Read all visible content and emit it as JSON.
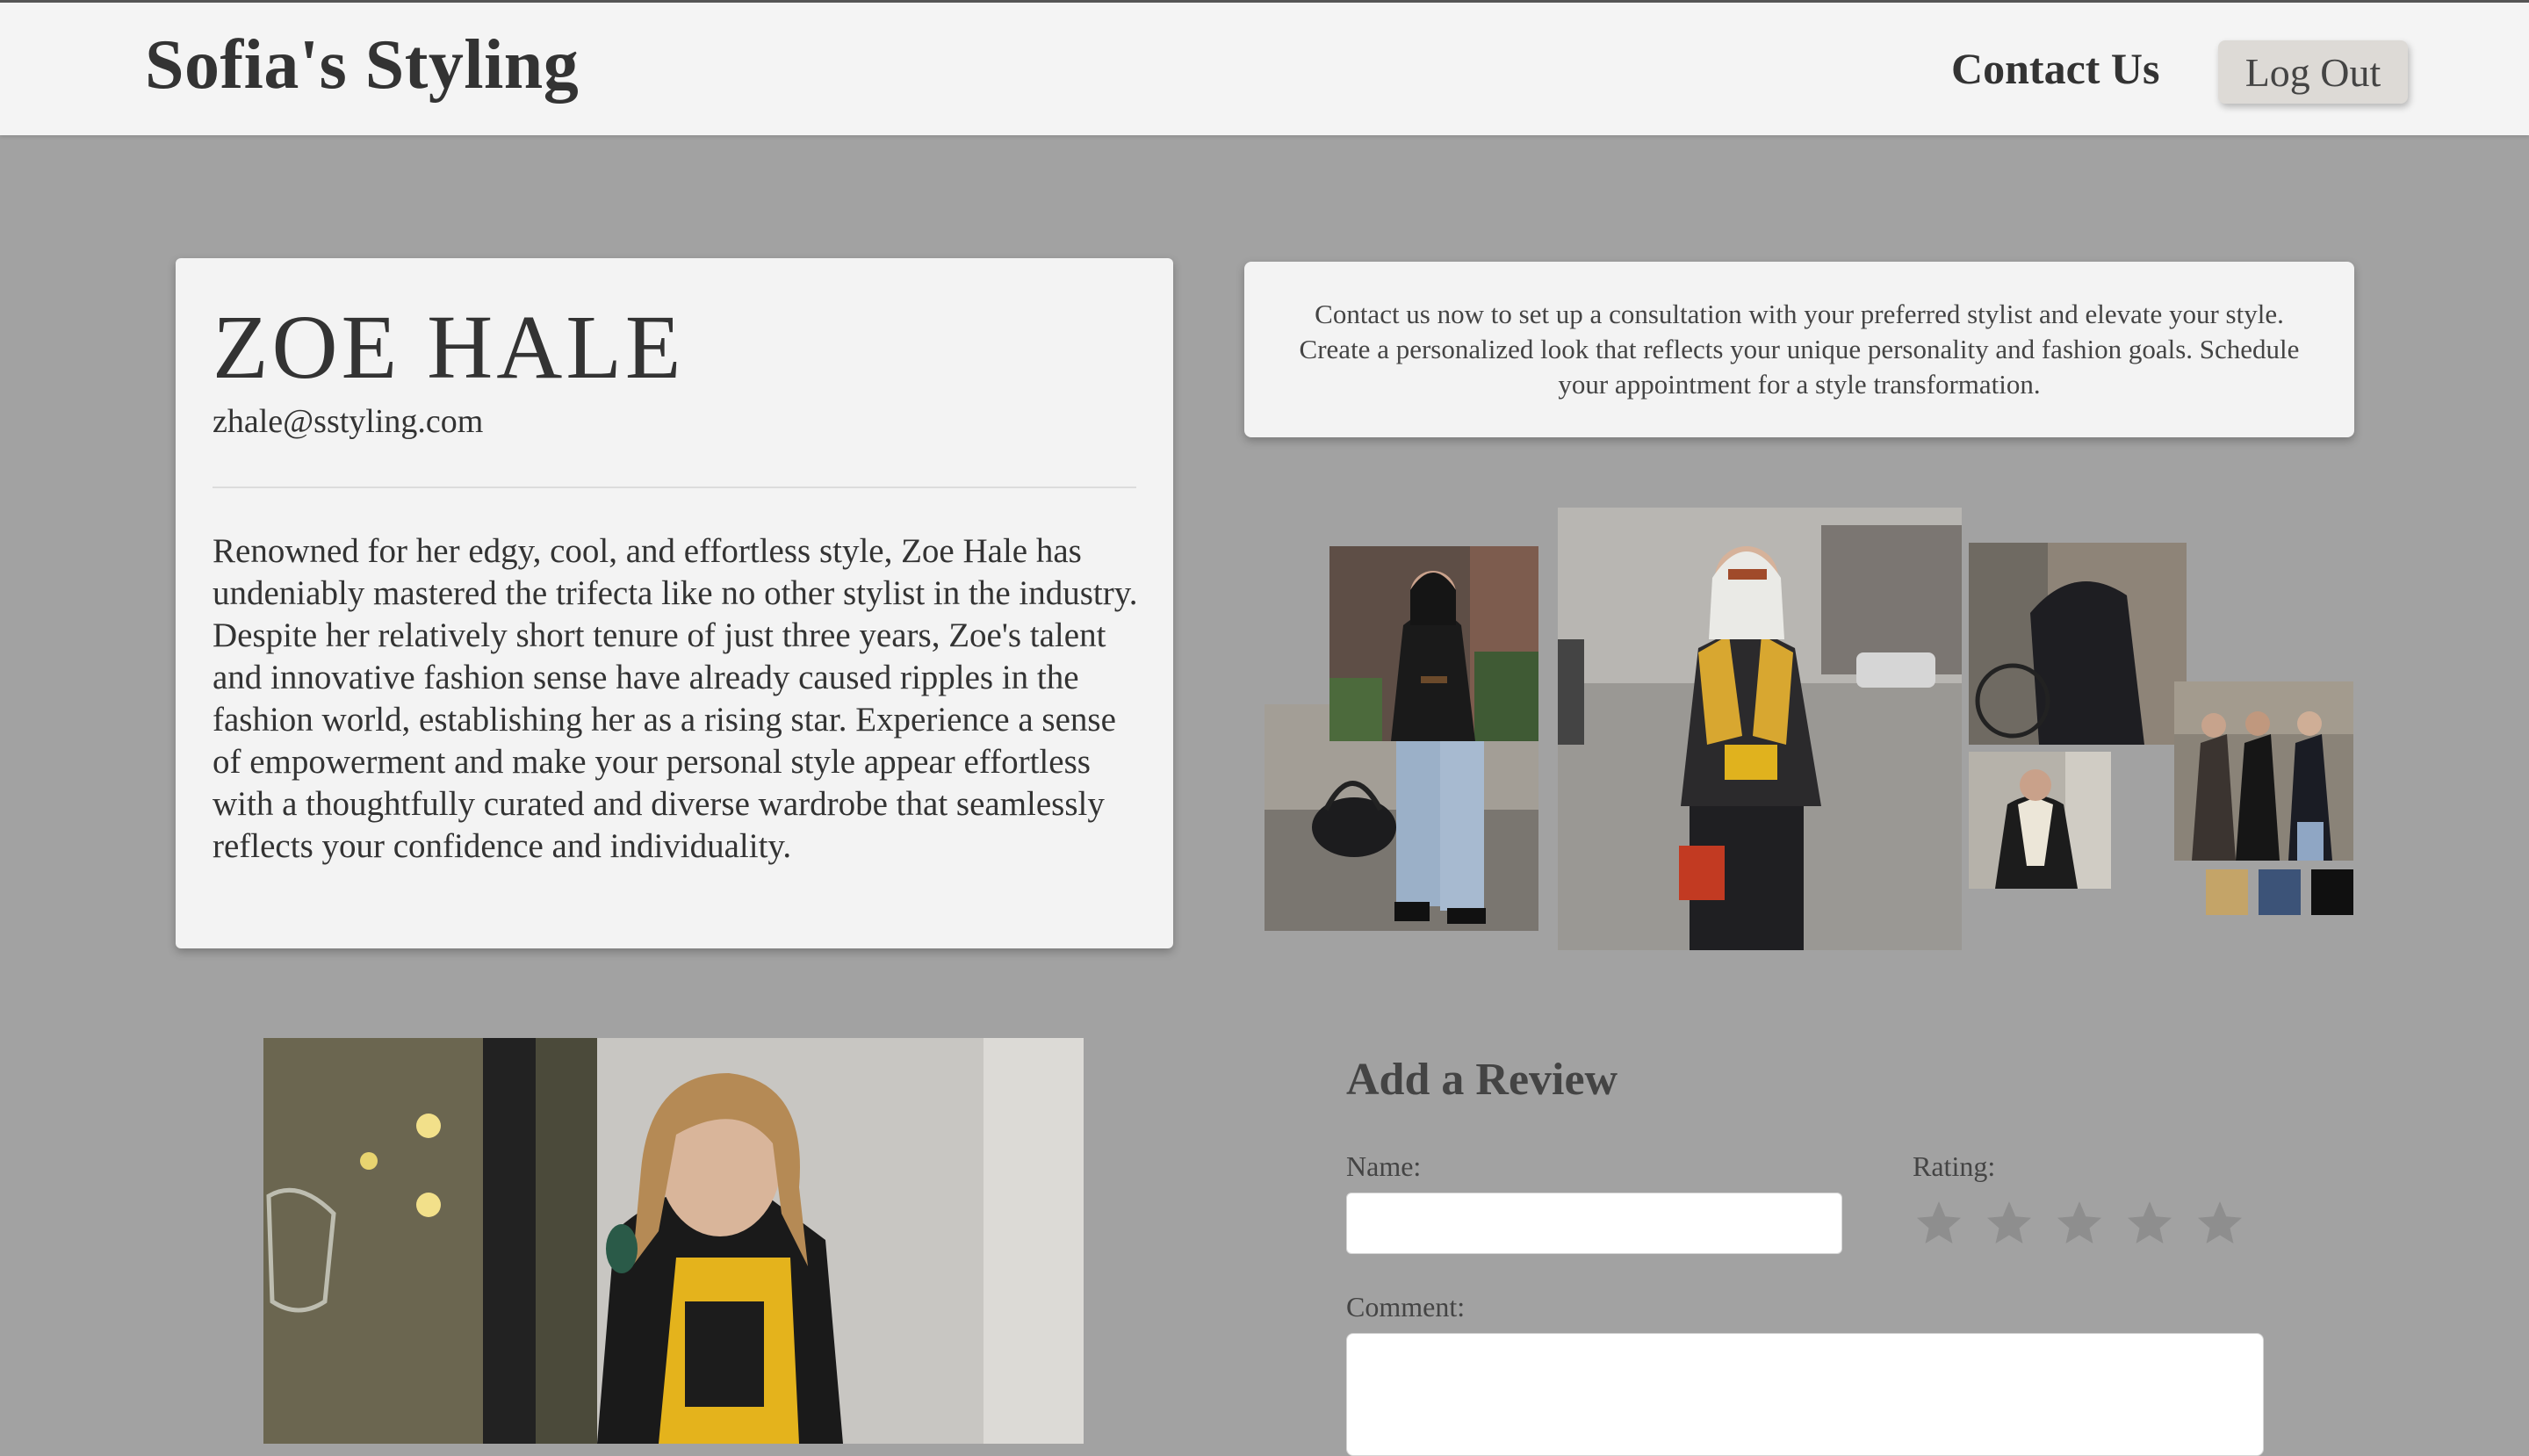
{
  "header": {
    "brand": "Sofia's Styling",
    "nav_contact": "Contact Us",
    "nav_logout": "Log Out"
  },
  "profile": {
    "name": "ZOE HALE",
    "email": "zhale@sstyling.com",
    "bio": "Renowned for her edgy, cool, and effortless style, Zoe Hale has undeniably mastered the trifecta like no other stylist in the industry. Despite her relatively short tenure of just three years, Zoe's talent and innovative fashion sense have already caused ripples in the fashion world, establishing her as a rising star. Experience a sense of empowerment and make your personal style appear effortless with a thoughtfully curated and diverse wardrobe that seamlessly reflects your confidence and individuality."
  },
  "contact_box": {
    "text": "Contact us now to set up a consultation with your preferred stylist and elevate your style. Create a personalized look that reflects your unique personality and fashion goals. Schedule your appointment for a style transformation."
  },
  "collage": {
    "palette": [
      "#c4a468",
      "#3c5378",
      "#101010"
    ]
  },
  "review": {
    "title": "Add a Review",
    "name_label": "Name:",
    "name_value": "",
    "rating_label": "Rating:",
    "rating_value": 0,
    "rating_max": 5,
    "comment_label": "Comment:",
    "comment_value": ""
  },
  "colors": {
    "page_bg": "#a2a2a2",
    "card_bg": "#f3f3f3",
    "star_inactive": "#8e8e8e"
  }
}
